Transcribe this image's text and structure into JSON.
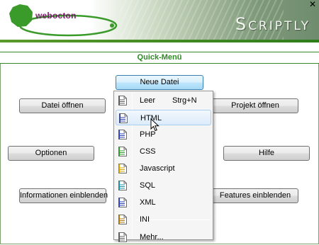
{
  "header": {
    "logo_text": "webocton",
    "app_title": "Scriptly",
    "close_glyph": "✕",
    "close_icon": "close-icon",
    "colors": {
      "brand_green": "#2f8a26",
      "logo_purple": "#7a1a6e"
    }
  },
  "quick_menu": {
    "title": "Quick-Menü"
  },
  "buttons": {
    "new_file": "Neue Datei",
    "open_file": "Datei öffnen",
    "open_project": "Projekt öffnen",
    "options": "Optionen",
    "help": "Hilfe",
    "show_info": "Informationen einblenden",
    "show_features": "Features einblenden"
  },
  "new_file_menu": {
    "items": [
      {
        "label": "Leer",
        "shortcut": "Strg+N",
        "icon": "blank-file-icon",
        "color": "#5b5b5b"
      },
      {
        "label": "HTML",
        "icon": "html-file-icon",
        "color": "#2a3fb0",
        "highlighted": true
      },
      {
        "label": "PHP",
        "icon": "php-file-icon",
        "color": "#2a3fb0"
      },
      {
        "label": "CSS",
        "icon": "css-file-icon",
        "color": "#2e9a2e"
      },
      {
        "label": "Javascript",
        "icon": "javascript-file-icon",
        "color": "#d9a400"
      },
      {
        "label": "SQL",
        "icon": "sql-file-icon",
        "color": "#1f8fa8"
      },
      {
        "label": "XML",
        "icon": "xml-file-icon",
        "color": "#2a3fb0"
      },
      {
        "label": "INI",
        "icon": "ini-file-icon",
        "color": "#b07a10"
      },
      {
        "label": "Mehr...",
        "icon": "more-files-icon",
        "color": "#5b5b5b"
      }
    ]
  }
}
